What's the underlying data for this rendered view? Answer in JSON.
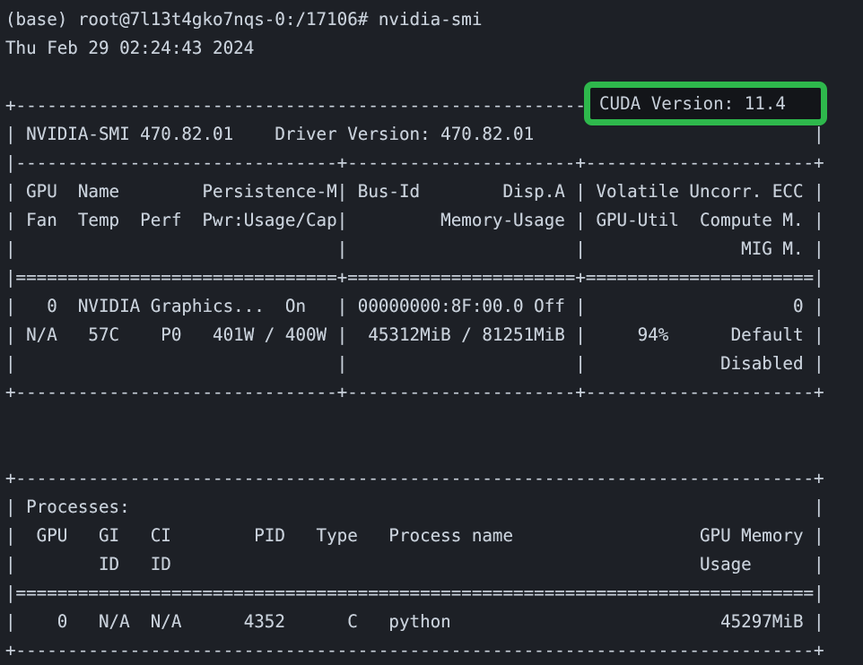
{
  "terminal": {
    "background_color": "#1d2026",
    "text_color": "#c8d0da",
    "prompt_line": "(base) root@7l13t4gko7nqs-0:/17106# nvidia-smi",
    "timestamp_line": "Thu Feb 29 02:24:43 2024"
  },
  "highlight": {
    "label": "CUDA Version: 11.4",
    "border_color": "#2eb84c",
    "fill_color": "#131519"
  },
  "smi": {
    "header": {
      "top_border": "+-----------------------------------------------------------------------------+",
      "version_row": "| NVIDIA-SMI 470.82.01    Driver Version: 470.82.01    CUDA Version: 11.4     |",
      "version_row_masked": "| NVIDIA-SMI 470.82.01    Driver Version: 470.82.01                           |",
      "rule_row": "|-------------------------------+----------------------+----------------------+",
      "col_row_1": "| GPU  Name        Persistence-M| Bus-Id        Disp.A | Volatile Uncorr. ECC |",
      "col_row_2": "| Fan  Temp  Perf  Pwr:Usage/Cap|         Memory-Usage | GPU-Util  Compute M. |",
      "col_row_3": "|                               |                      |               MIG M. |",
      "double_rule": "|===============================+======================+======================|"
    },
    "gpu_rows": [
      "|   0  NVIDIA Graphics...  On   | 00000000:8F:00.0 Off |                    0 |",
      "| N/A   57C    P0   401W / 400W |  45312MiB / 81251MiB |     94%      Default |",
      "|                               |                      |             Disabled |"
    ],
    "bottom_border": "+-------------------------------+----------------------+----------------------+",
    "blank": " "
  },
  "processes": {
    "top_border": "+-----------------------------------------------------------------------------+",
    "title_row": "| Processes:                                                                  |",
    "col_row_1": "|  GPU   GI   CI        PID   Type   Process name                  GPU Memory |",
    "col_row_2": "|        ID   ID                                                   Usage      |",
    "double_rule": "|=============================================================================|",
    "rows": [
      "|    0   N/A  N/A      4352      C   python                          45297MiB |"
    ],
    "bottom_border": "+-----------------------------------------------------------------------------+"
  },
  "fields": {
    "nvidia_smi_version": "470.82.01",
    "driver_version": "470.82.01",
    "cuda_version": "11.4",
    "gpu_index": "0",
    "gpu_name": "NVIDIA Graphics...",
    "persistence_mode": "On",
    "bus_id": "00000000:8F:00.0",
    "display_active": "Off",
    "uncorrected_ecc": "0",
    "fan": "N/A",
    "temperature": "57C",
    "performance_state": "P0",
    "power_usage": "401W",
    "power_cap": "400W",
    "memory_used": "45312MiB",
    "memory_total": "81251MiB",
    "gpu_util": "94%",
    "compute_mode": "Default",
    "mig_mode": "Disabled",
    "process_gpu": "0",
    "process_gi_id": "N/A",
    "process_ci_id": "N/A",
    "process_pid": "4352",
    "process_type": "C",
    "process_name": "python",
    "process_memory": "45297MiB"
  }
}
